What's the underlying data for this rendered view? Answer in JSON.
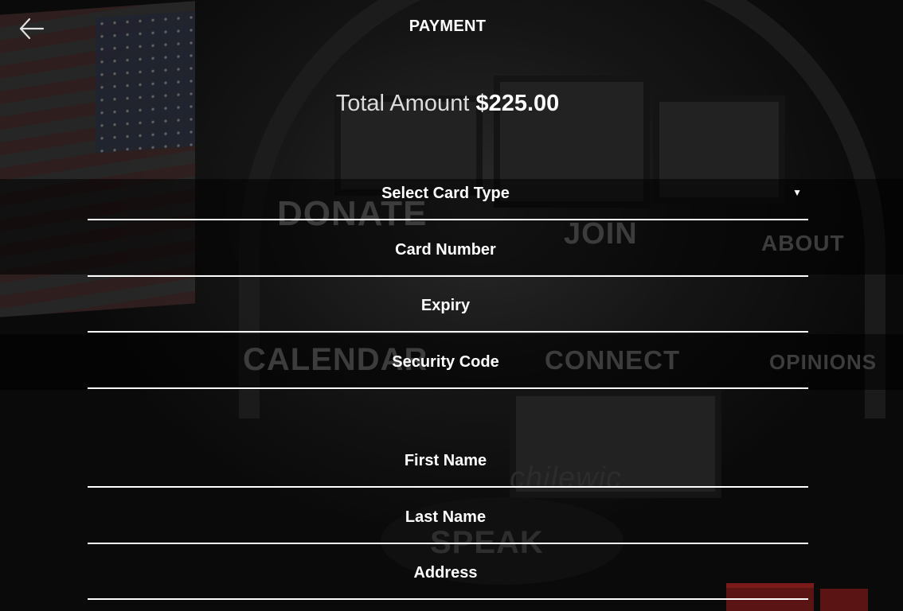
{
  "header": {
    "title": "PAYMENT"
  },
  "total": {
    "label": "Total Amount",
    "amount": "$225.00"
  },
  "card_fields": {
    "card_type_placeholder": "Select Card Type",
    "card_number_placeholder": "Card Number",
    "expiry_placeholder": "Expiry",
    "security_code_placeholder": "Security Code"
  },
  "billing_fields": {
    "first_name_placeholder": "First Name",
    "last_name_placeholder": "Last Name",
    "address_placeholder": "Address"
  },
  "background_menu": {
    "donate": "DONATE",
    "join": "JOIN",
    "about": "ABOUT",
    "calendar": "CALENDAR",
    "connect": "CONNECT",
    "opinions": "OPINIONS",
    "speak": "SPEAK",
    "storefront_text": "chilewic"
  },
  "icons": {
    "back": "arrow-left-icon",
    "dropdown": "caret-down-icon"
  },
  "colors": {
    "text": "#ffffff",
    "underline": "#ffffff",
    "background": "#0b0b0b"
  }
}
